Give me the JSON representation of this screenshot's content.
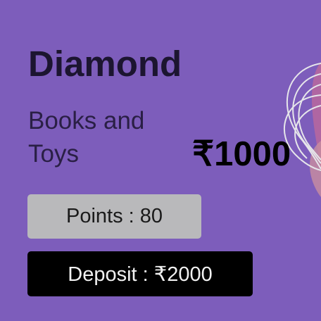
{
  "card": {
    "title": "Diamond",
    "subtitle": "Books and Toys",
    "price": "₹1000",
    "points_label": "Points : 80",
    "deposit_label": "Deposit : ₹2000"
  },
  "colors": {
    "background": "#7d5dbb",
    "points_bg": "#b9b9bb",
    "deposit_bg": "#000000",
    "decor_line": "#e6e6ea",
    "decor_fill": "#b9679e"
  },
  "icons": {
    "decoration": "wavy-lines-decoration"
  }
}
